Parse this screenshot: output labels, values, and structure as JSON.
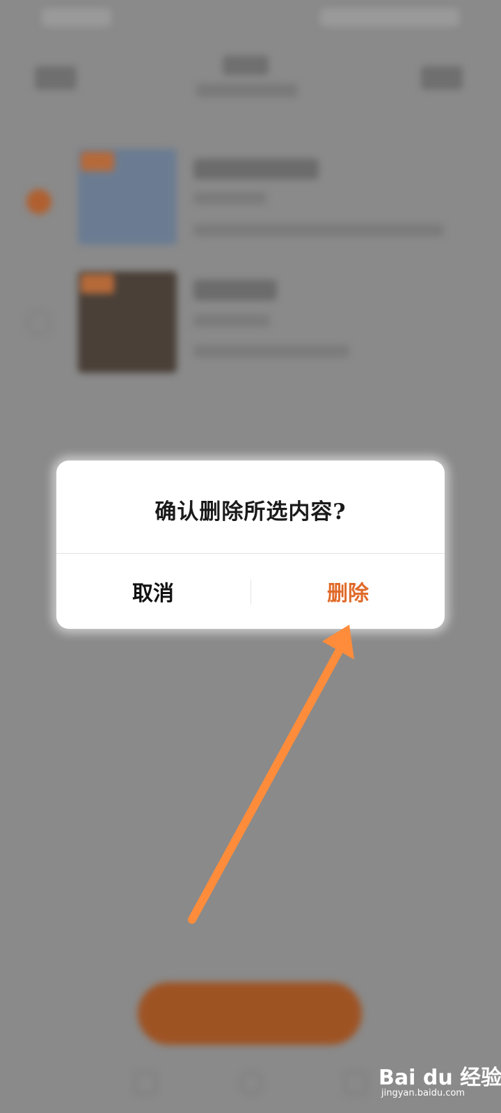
{
  "dialog": {
    "title": "确认删除所选内容?",
    "cancel_label": "取消",
    "delete_label": "删除"
  },
  "colors": {
    "accent": "#e06a2a",
    "annotation_arrow": "#ff8c3a",
    "overlay": "#8a8a8a"
  },
  "watermark": {
    "brand": "Bai du 经验",
    "url": "jingyan.baidu.com"
  }
}
